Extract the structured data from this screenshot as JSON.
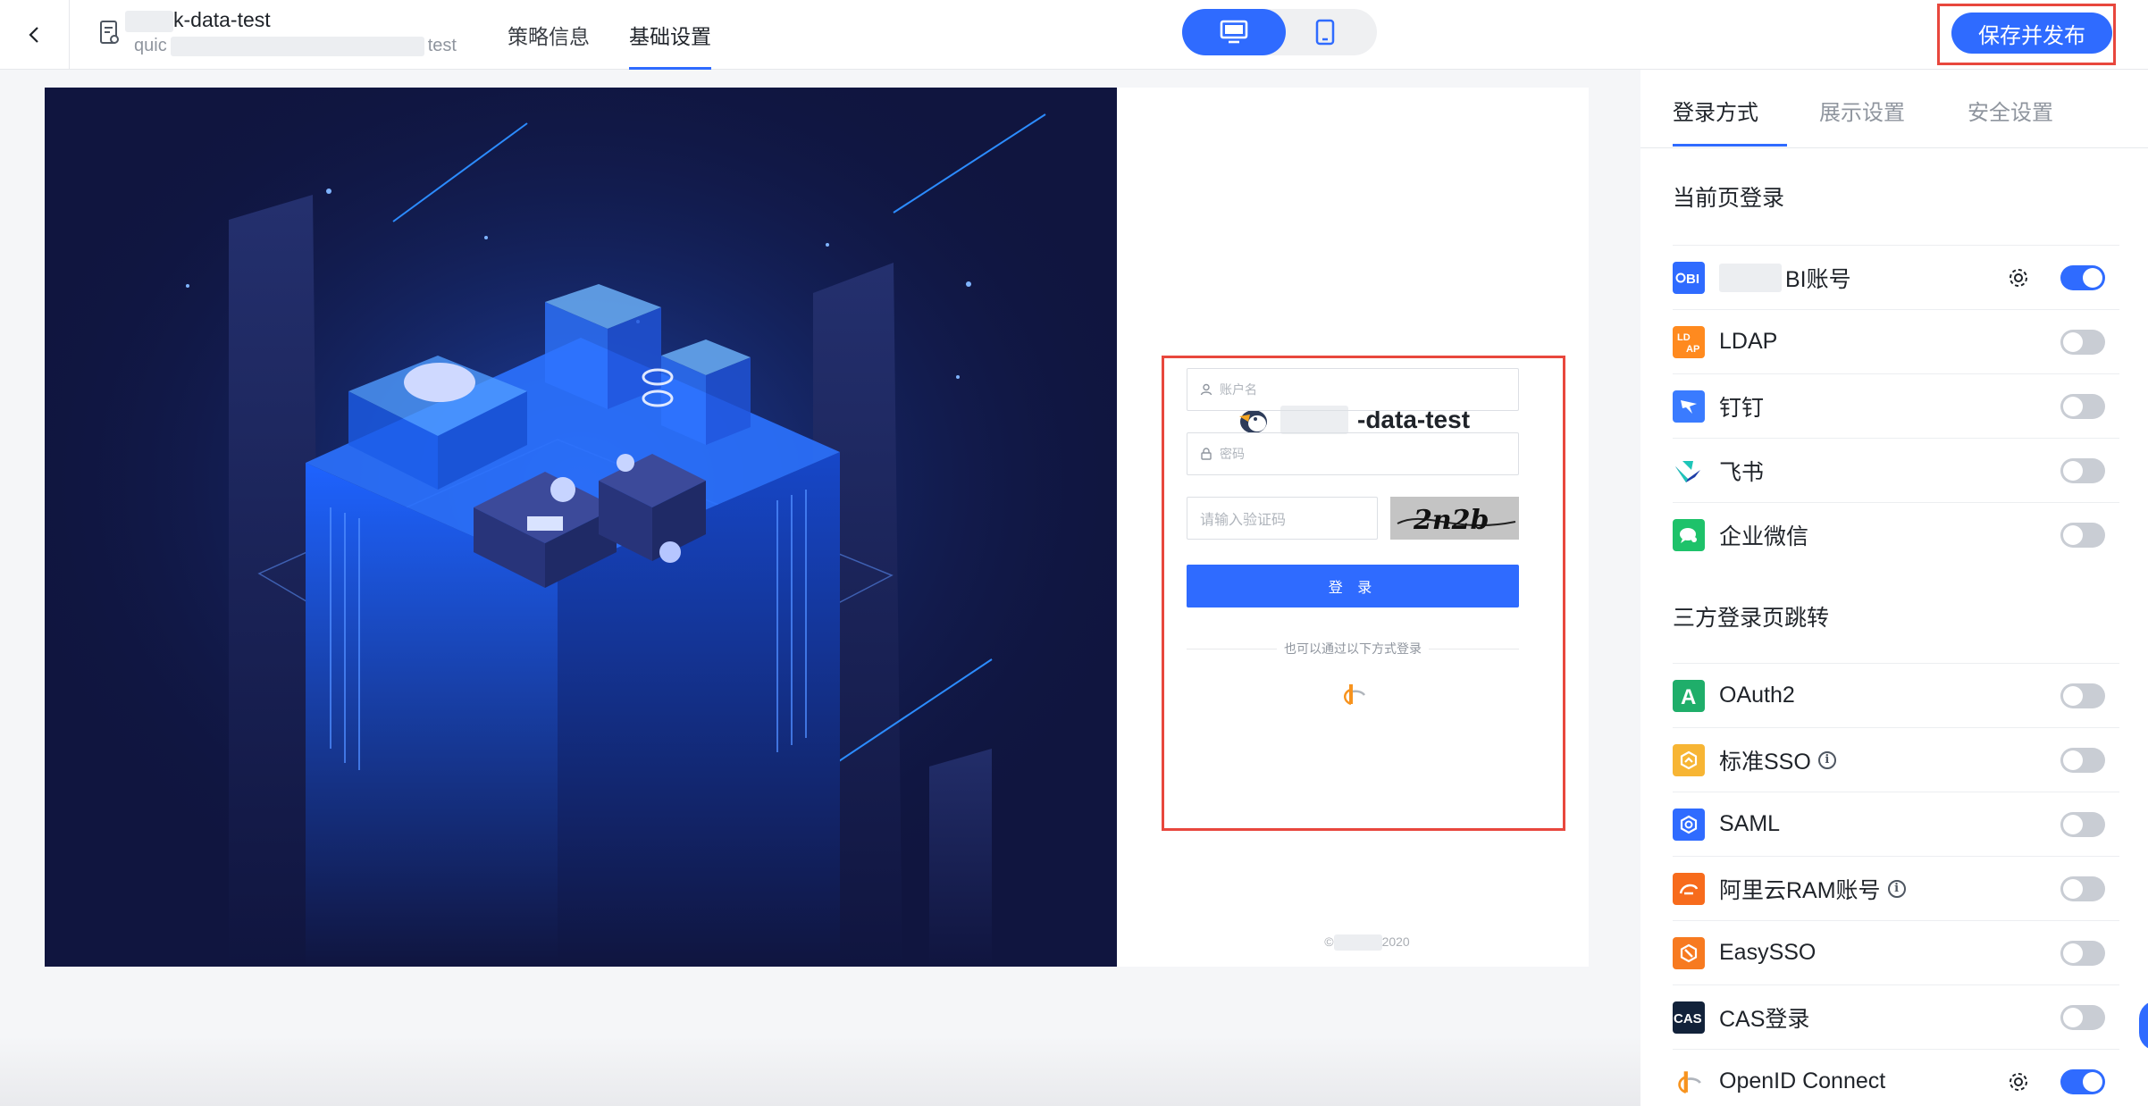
{
  "header": {
    "back_icon": "chevron-left-icon",
    "doc_icon": "document-icon",
    "title": "k-data-test",
    "subtitle_prefix": "quic",
    "subtitle_suffix": "test",
    "tabs": [
      {
        "label": "策略信息",
        "active": false
      },
      {
        "label": "基础设置",
        "active": true
      }
    ],
    "device_switch": {
      "desktop_icon": "desktop-icon",
      "mobile_icon": "mobile-icon",
      "active": "desktop"
    },
    "publish_label": "保存并发布"
  },
  "preview": {
    "brand_suffix": "-data-test",
    "username_placeholder": "账户名",
    "password_placeholder": "密码",
    "captcha_placeholder": "请输入验证码",
    "captcha_text": "2n2b",
    "login_label": "登 录",
    "alt_login_text": "也可以通过以下方式登录",
    "copyright_prefix": "©",
    "copyright_suffix": "2020"
  },
  "panel": {
    "tabs": [
      {
        "label": "登录方式",
        "active": true
      },
      {
        "label": "展示设置",
        "active": false
      },
      {
        "label": "安全设置",
        "active": false
      }
    ],
    "section_current": "当前页登录",
    "current_methods": [
      {
        "label": "BI账号",
        "icon": "quickbi-icon",
        "color": "#2f6bff",
        "gear": true,
        "enabled": true
      },
      {
        "label": "LDAP",
        "icon": "ldap-icon",
        "color": "#ff8a1f",
        "gear": false,
        "enabled": false
      },
      {
        "label": "钉钉",
        "icon": "dingtalk-icon",
        "color": "#3a7bff",
        "gear": false,
        "enabled": false
      },
      {
        "label": "飞书",
        "icon": "feishu-icon",
        "color": "#1ec5b8",
        "gear": false,
        "enabled": false
      },
      {
        "label": "企业微信",
        "icon": "wecom-icon",
        "color": "#1ec26a",
        "gear": false,
        "enabled": false
      }
    ],
    "section_thirdparty": "三方登录页跳转",
    "thirdparty_methods": [
      {
        "label": "OAuth2",
        "icon": "oauth2-icon",
        "color": "#1fae6a",
        "info": false,
        "gear": false,
        "enabled": false
      },
      {
        "label": "标准SSO",
        "icon": "sso-icon",
        "color": "#f7b534",
        "info": true,
        "gear": false,
        "enabled": false
      },
      {
        "label": "SAML",
        "icon": "saml-icon",
        "color": "#2f6bff",
        "info": false,
        "gear": false,
        "enabled": false
      },
      {
        "label": "阿里云RAM账号",
        "icon": "aliyun-ram-icon",
        "color": "#f76b1c",
        "info": true,
        "gear": false,
        "enabled": false
      },
      {
        "label": "EasySSO",
        "icon": "easysso-icon",
        "color": "#f77a20",
        "info": false,
        "gear": false,
        "enabled": false
      },
      {
        "label": "CAS登录",
        "icon": "cas-icon",
        "color": "#12223a",
        "info": false,
        "gear": false,
        "enabled": false
      },
      {
        "label": "OpenID Connect",
        "icon": "openid-icon",
        "color": "#f7931e",
        "info": false,
        "gear": true,
        "enabled": true
      }
    ]
  },
  "colors": {
    "accent": "#2f6bff",
    "highlight_border": "#e8473d",
    "hero_bg": "#10153f"
  }
}
